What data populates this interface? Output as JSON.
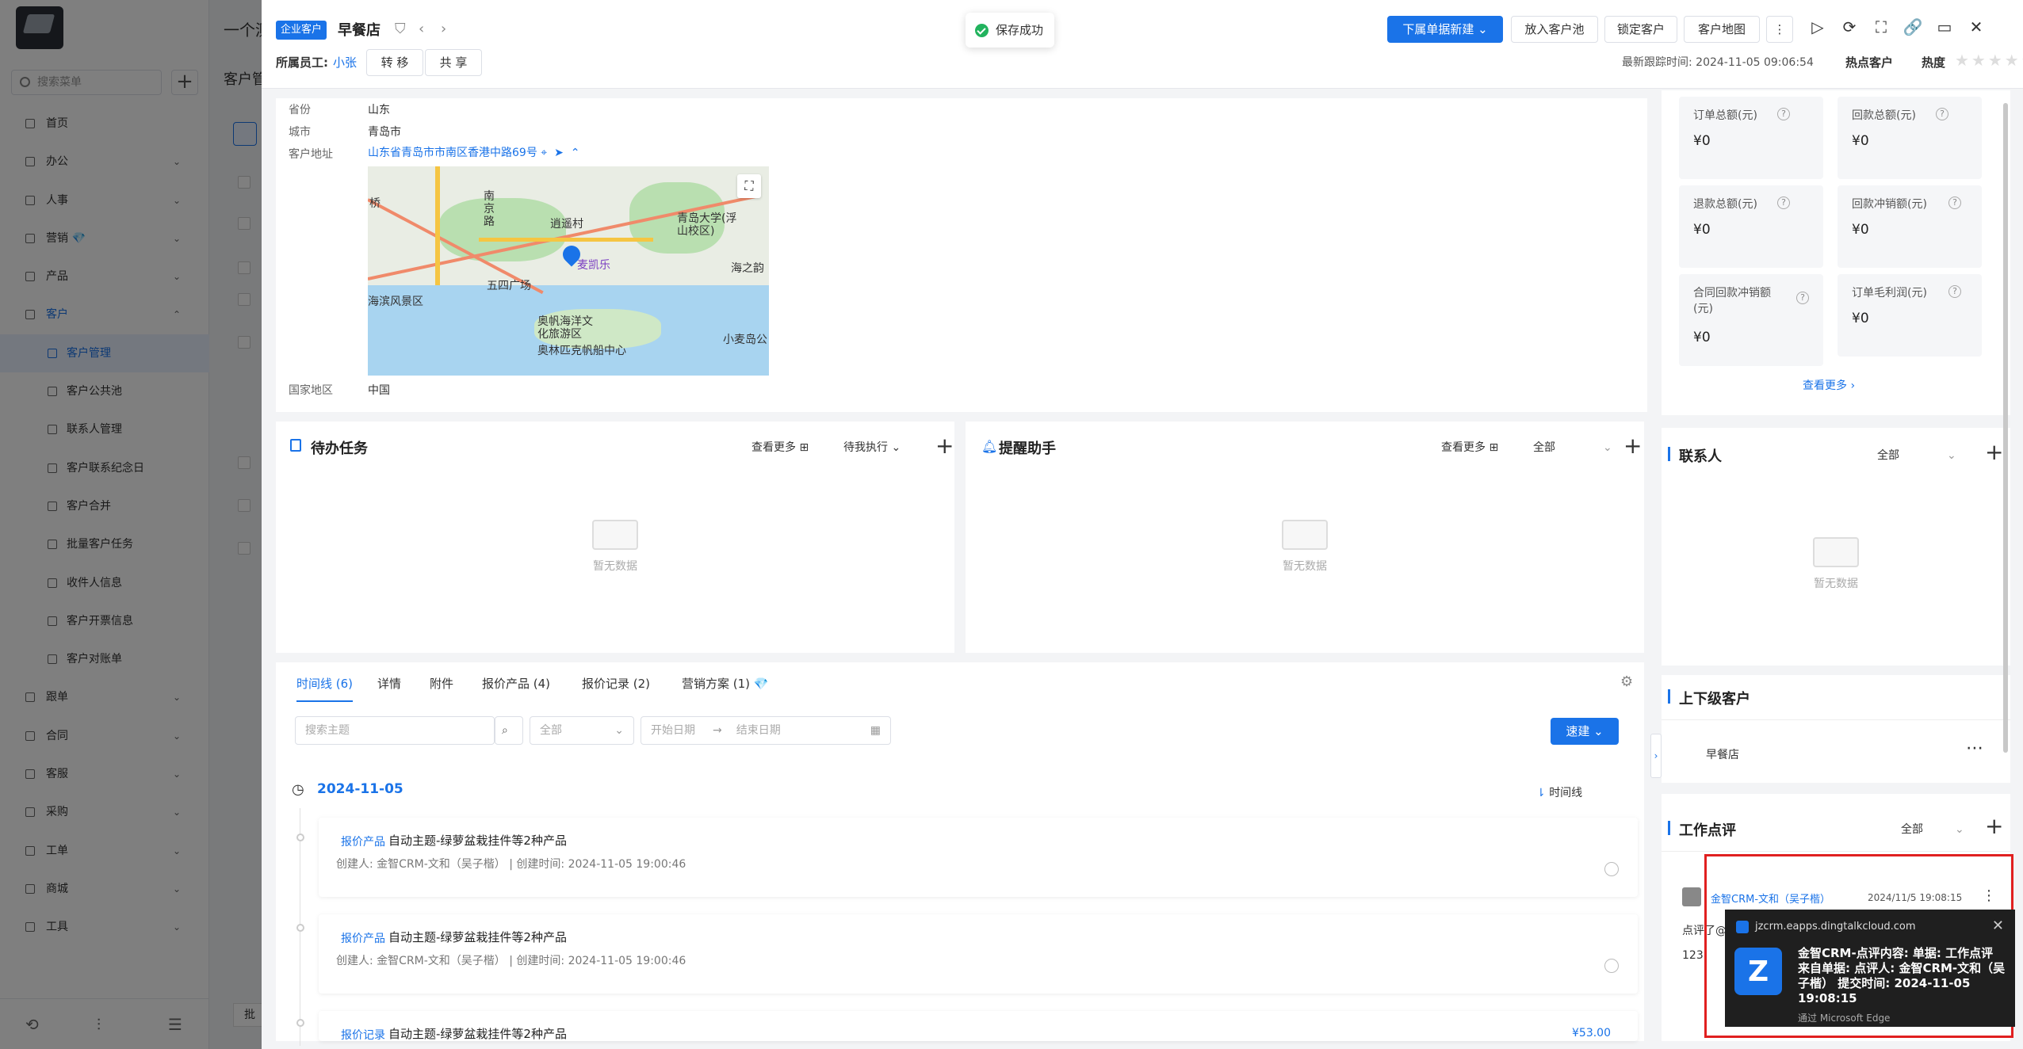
{
  "sidebar": {
    "search_placeholder": "搜索菜单",
    "items": [
      {
        "label": "首页",
        "chev": ""
      },
      {
        "label": "办公",
        "chev": "⌄"
      },
      {
        "label": "人事",
        "chev": "⌄"
      },
      {
        "label": "营销 💎",
        "chev": "⌄"
      },
      {
        "label": "产品",
        "chev": "⌄"
      },
      {
        "label": "客户",
        "chev": "⌃"
      },
      {
        "label": "客户管理",
        "chev": ""
      },
      {
        "label": "客户公共池",
        "chev": ""
      },
      {
        "label": "联系人管理",
        "chev": ""
      },
      {
        "label": "客户联系纪念日",
        "chev": ""
      },
      {
        "label": "客户合并",
        "chev": ""
      },
      {
        "label": "批量客户任务",
        "chev": ""
      },
      {
        "label": "收件人信息",
        "chev": ""
      },
      {
        "label": "客户开票信息",
        "chev": ""
      },
      {
        "label": "客户对账单",
        "chev": ""
      },
      {
        "label": "跟单",
        "chev": "⌄"
      },
      {
        "label": "合同",
        "chev": "⌄"
      },
      {
        "label": "客服",
        "chev": "⌄"
      },
      {
        "label": "采购",
        "chev": "⌄"
      },
      {
        "label": "工单",
        "chev": "⌄"
      },
      {
        "label": "商城",
        "chev": "⌄"
      },
      {
        "label": "工具",
        "chev": "⌄"
      }
    ],
    "footer_icons": [
      "history-icon",
      "filter-icon",
      "collapse-icon"
    ]
  },
  "background": {
    "title": "一个测",
    "section": "客户管",
    "pager": "批"
  },
  "header": {
    "tag": "企业客户",
    "customer_name": "早餐店",
    "owner_label": "所属员工:",
    "owner_name": "小张",
    "transfer": "转 移",
    "share": "共 享",
    "toast": "保存成功",
    "order_new": "下属单据新建 ⌄",
    "to_pool": "放入客户池",
    "lock": "锁定客户",
    "map": "客户地图",
    "last_follow": "最新跟踪时间: 2024-11-05 09:06:54",
    "hot_label": "热点客户",
    "heat_label": "热度",
    "stars": "★★★★★"
  },
  "address": {
    "province_label": "省份",
    "province": "山东",
    "city_label": "城市",
    "city": "青岛市",
    "address_label": "客户地址",
    "address": "山东省青岛市市南区香港中路69号",
    "country_label": "国家地区",
    "country": "中国",
    "map_labels": [
      "麦凯乐",
      "逍遥村",
      "青岛大学(浮山校区)",
      "五四广场",
      "海滨风景区",
      "奥帆海洋文化旅游区",
      "奥林匹克帆船中心",
      "小麦岛公",
      "海之韵",
      "南京路",
      "桥"
    ]
  },
  "tasks": {
    "title": "待办任务",
    "more": "查看更多",
    "filter": "待我执行 ⌄",
    "empty": "暂无数据"
  },
  "reminder": {
    "title": "提醒助手",
    "more": "查看更多",
    "filter": "全部",
    "empty": "暂无数据"
  },
  "timeline": {
    "tabs": [
      "时间线 (6)",
      "详情",
      "附件",
      "报价产品 (4)",
      "报价记录 (2)",
      "营销方案 (1) 💎"
    ],
    "search_placeholder": "搜索主题",
    "all": "全部",
    "start_date": "开始日期",
    "end_date": "结束日期",
    "quick_new": "速建 ⌄",
    "date": "2024-11-05",
    "toggle": "时间线",
    "entries": [
      {
        "type": "报价产品",
        "title": "自动主题-绿萝盆栽挂件等2种产品",
        "meta": "创建人: 金智CRM-文和（吴子楷）  |  创建时间: 2024-11-05 19:00:46",
        "amount": ""
      },
      {
        "type": "报价产品",
        "title": "自动主题-绿萝盆栽挂件等2种产品",
        "meta": "创建人: 金智CRM-文和（吴子楷）  |  创建时间: 2024-11-05 19:00:46",
        "amount": ""
      },
      {
        "type": "报价记录",
        "title": "自动主题-绿萝盆栽挂件等2种产品",
        "meta": "",
        "amount": "¥53.00"
      }
    ]
  },
  "stats": {
    "items": [
      {
        "label": "订单总额(元)",
        "value": "¥0"
      },
      {
        "label": "回款总额(元)",
        "value": "¥0"
      },
      {
        "label": "退款总额(元)",
        "value": "¥0"
      },
      {
        "label": "回款冲销额(元)",
        "value": "¥0"
      },
      {
        "label": "合同回款冲销额(元)",
        "value": "¥0"
      },
      {
        "label": "订单毛利润(元)",
        "value": "¥0"
      }
    ],
    "more": "查看更多 ›"
  },
  "contacts": {
    "title": "联系人",
    "filter": "全部",
    "empty": "暂无数据"
  },
  "hierarchy": {
    "title": "上下级客户",
    "item": "早餐店"
  },
  "review": {
    "title": "工作点评",
    "filter": "全部",
    "author": "金智CRM-文和（吴子楷）",
    "time": "2024/11/5 19:08:15",
    "text1": "点评了@",
    "text2": "123"
  },
  "notification": {
    "domain": "jzcrm.eapps.dingtalkcloud.com",
    "message": "金智CRM-点评内容:  单据: 工作点评 来自单据:  点评人: 金智CRM-文和（吴子楷） 提交时间: 2024-11-05 19:08:15",
    "via": "通过 Microsoft Edge"
  }
}
